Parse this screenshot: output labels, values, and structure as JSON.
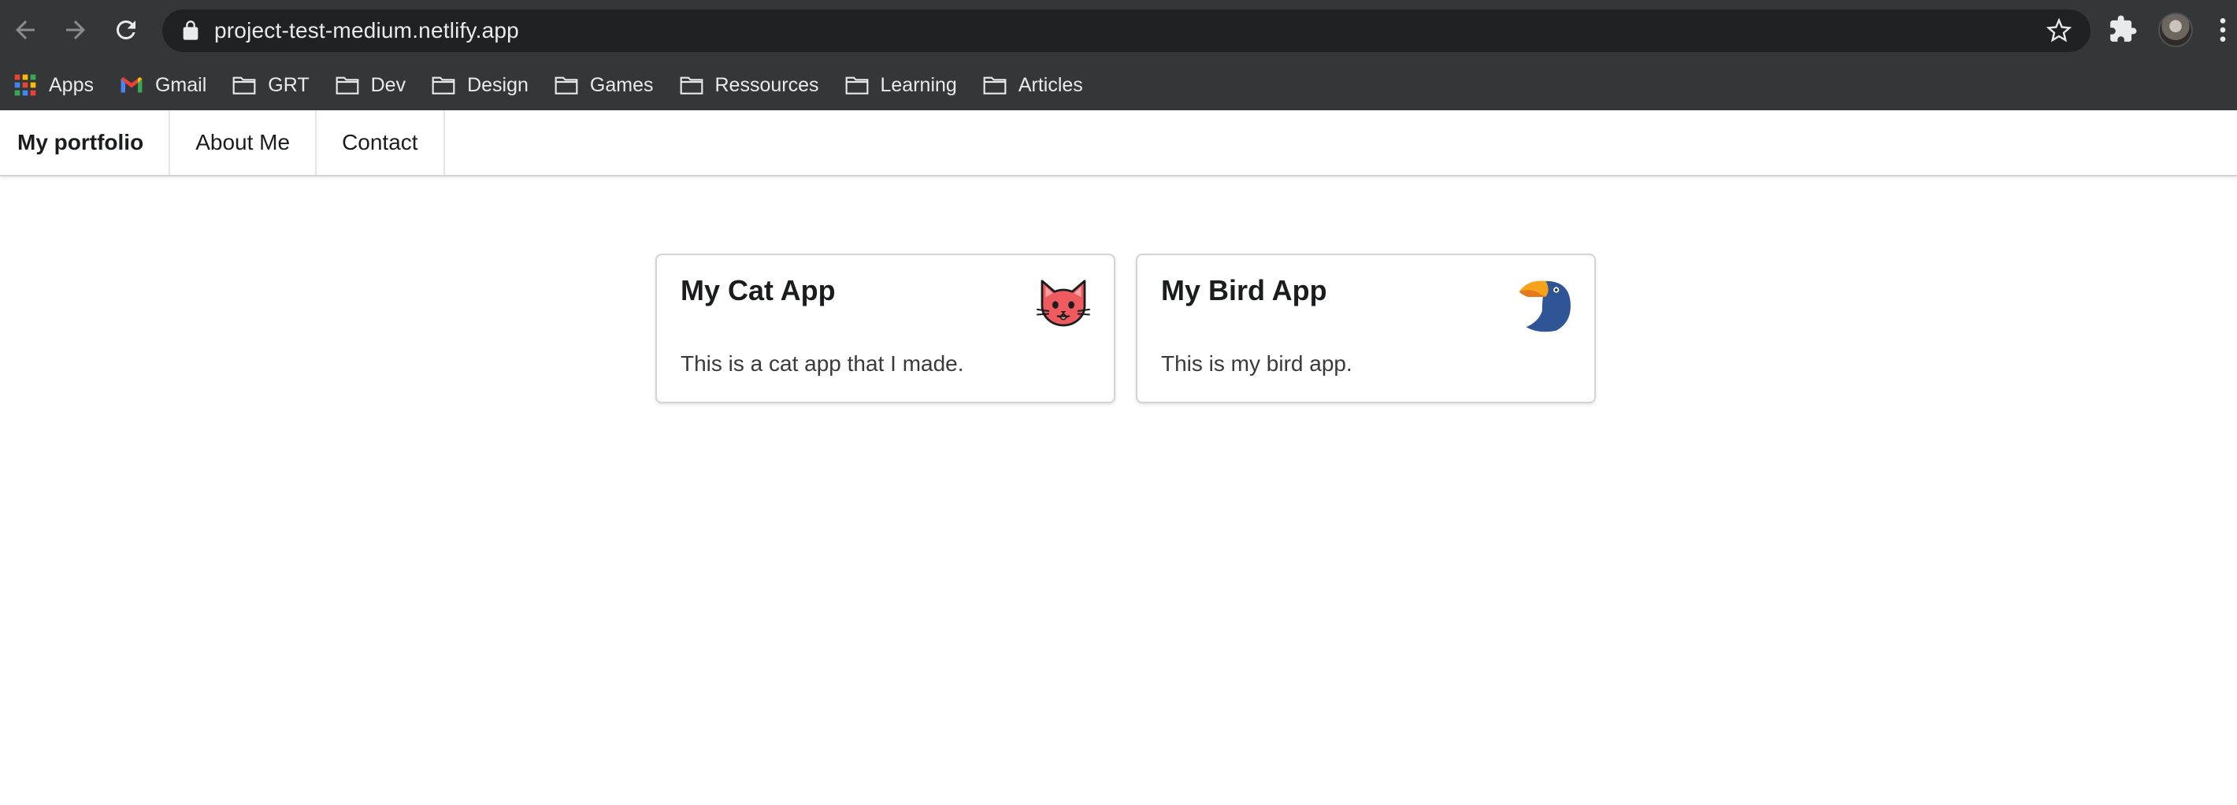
{
  "browser": {
    "url": "project-test-medium.netlify.app",
    "bookmarks": [
      {
        "label": "Apps",
        "icon": "apps-grid-icon"
      },
      {
        "label": "Gmail",
        "icon": "gmail-icon"
      },
      {
        "label": "GRT",
        "icon": "folder-icon"
      },
      {
        "label": "Dev",
        "icon": "folder-icon"
      },
      {
        "label": "Design",
        "icon": "folder-icon"
      },
      {
        "label": "Games",
        "icon": "folder-icon"
      },
      {
        "label": "Ressources",
        "icon": "folder-icon"
      },
      {
        "label": "Learning",
        "icon": "folder-icon"
      },
      {
        "label": "Articles",
        "icon": "folder-icon"
      }
    ],
    "colors": {
      "chrome": "#353637",
      "omnibox": "#202124",
      "text": "#e8eaed"
    }
  },
  "site": {
    "nav": {
      "brand": "My portfolio",
      "about": "About Me",
      "contact": "Contact"
    },
    "cards": [
      {
        "title": "My Cat App",
        "description": "This is a cat app that I made.",
        "icon": "cat-face-icon"
      },
      {
        "title": "My Bird App",
        "description": "This is my bird app.",
        "icon": "toucan-icon"
      }
    ]
  }
}
